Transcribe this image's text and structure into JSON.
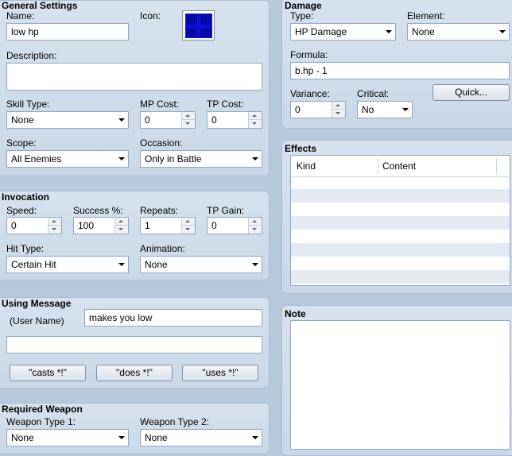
{
  "general": {
    "title": "General Settings",
    "name_label": "Name:",
    "name_value": "low hp",
    "icon_label": "Icon:",
    "icon_name": "blue-tile-icon",
    "description_label": "Description:",
    "description_value": "",
    "skill_type_label": "Skill Type:",
    "skill_type_value": "None",
    "mp_cost_label": "MP Cost:",
    "mp_cost_value": "0",
    "tp_cost_label": "TP Cost:",
    "tp_cost_value": "0",
    "scope_label": "Scope:",
    "scope_value": "All Enemies",
    "occasion_label": "Occasion:",
    "occasion_value": "Only in Battle"
  },
  "invocation": {
    "title": "Invocation",
    "speed_label": "Speed:",
    "speed_value": "0",
    "success_label": "Success %:",
    "success_value": "100",
    "repeats_label": "Repeats:",
    "repeats_value": "1",
    "tp_gain_label": "TP Gain:",
    "tp_gain_value": "0",
    "hit_type_label": "Hit Type:",
    "hit_type_value": "Certain Hit",
    "animation_label": "Animation:",
    "animation_value": "None"
  },
  "message": {
    "title": "Using Message",
    "user_name_label": "(User Name)",
    "line1_value": "makes you low",
    "line2_value": "",
    "casts_button": "\"casts *!\"",
    "does_button": "\"does *!\"",
    "uses_button": "\"uses *!\""
  },
  "weapon": {
    "title": "Required Weapon",
    "type1_label": "Weapon Type 1:",
    "type1_value": "None",
    "type2_label": "Weapon Type 2:",
    "type2_value": "None"
  },
  "damage": {
    "title": "Damage",
    "type_label": "Type:",
    "type_value": "HP Damage",
    "element_label": "Element:",
    "element_value": "None",
    "formula_label": "Formula:",
    "formula_value": "b.hp - 1",
    "variance_label": "Variance:",
    "variance_value": "0",
    "critical_label": "Critical:",
    "critical_value": "No",
    "quick_button": "Quick..."
  },
  "effects": {
    "title": "Effects",
    "columns": [
      "Kind",
      "Content"
    ]
  },
  "note": {
    "title": "Note",
    "value": ""
  },
  "colors": {
    "background": "#b7c9dd",
    "icon_blue": "#0a0ad0"
  }
}
